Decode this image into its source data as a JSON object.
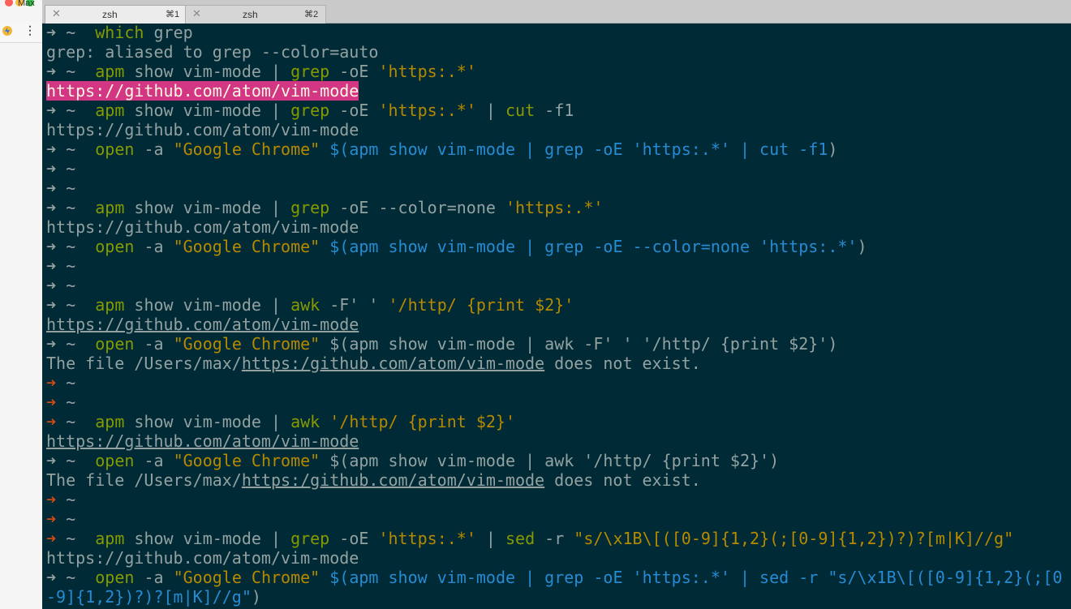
{
  "browser": {
    "window_label": "Max"
  },
  "tabs": [
    {
      "title": "zsh",
      "shortcut": "⌘1",
      "close": "✕"
    },
    {
      "title": "zsh",
      "shortcut": "⌘2",
      "close": "✕"
    }
  ],
  "colors": {
    "background": "#002b36",
    "prompt_arrow": "#93a1a1",
    "prompt_arrow_error": "#cb4b16",
    "command": "#859900",
    "string": "#b58900",
    "subshell": "#268bd2",
    "text": "#93a1a1",
    "highlight": "#d33682"
  },
  "terminal": {
    "lines": [
      {
        "k": "cmd",
        "err": false,
        "segs": [
          [
            "g",
            "which"
          ],
          [
            "t",
            " grep"
          ]
        ]
      },
      {
        "k": "out",
        "segs": [
          [
            "t",
            "grep: aliased to grep --color=auto"
          ]
        ]
      },
      {
        "k": "cmd",
        "err": false,
        "segs": [
          [
            "g",
            "apm"
          ],
          [
            "t",
            " show vim-mode | "
          ],
          [
            "g",
            "grep"
          ],
          [
            "t",
            " -oE "
          ],
          [
            "y",
            "'https:.*'"
          ]
        ]
      },
      {
        "k": "out",
        "segs": [
          [
            "hl",
            "https://github.com/atom/vim-mode"
          ]
        ]
      },
      {
        "k": "cmd",
        "err": false,
        "segs": [
          [
            "g",
            "apm"
          ],
          [
            "t",
            " show vim-mode | "
          ],
          [
            "g",
            "grep"
          ],
          [
            "t",
            " -oE "
          ],
          [
            "y",
            "'https:.*'"
          ],
          [
            "t",
            " | "
          ],
          [
            "g",
            "cut"
          ],
          [
            "t",
            " -f1"
          ]
        ]
      },
      {
        "k": "out",
        "segs": [
          [
            "t",
            "https://github.com/atom/vim-mode"
          ]
        ]
      },
      {
        "k": "cmd",
        "err": false,
        "segs": [
          [
            "g",
            "open"
          ],
          [
            "t",
            " -a "
          ],
          [
            "y",
            "\"Google Chrome\""
          ],
          [
            "t",
            " "
          ],
          [
            "b",
            "$(apm show vim-mode | grep -oE 'https:.*' | cut -f1"
          ],
          [
            "t",
            ")"
          ]
        ]
      },
      {
        "k": "cmd",
        "err": false,
        "segs": []
      },
      {
        "k": "cmd",
        "err": false,
        "segs": []
      },
      {
        "k": "cmd",
        "err": false,
        "segs": [
          [
            "g",
            "apm"
          ],
          [
            "t",
            " show vim-mode | "
          ],
          [
            "g",
            "grep"
          ],
          [
            "t",
            " -oE --color=none "
          ],
          [
            "y",
            "'https:.*'"
          ]
        ]
      },
      {
        "k": "out",
        "segs": [
          [
            "t",
            "https://github.com/atom/vim-mode"
          ]
        ]
      },
      {
        "k": "cmd",
        "err": false,
        "segs": [
          [
            "g",
            "open"
          ],
          [
            "t",
            " -a "
          ],
          [
            "y",
            "\"Google Chrome\""
          ],
          [
            "t",
            " "
          ],
          [
            "b",
            "$(apm show vim-mode | grep -oE --color=none 'https:.*'"
          ],
          [
            "t",
            ")"
          ]
        ]
      },
      {
        "k": "cmd",
        "err": false,
        "segs": []
      },
      {
        "k": "cmd",
        "err": false,
        "segs": []
      },
      {
        "k": "cmd",
        "err": false,
        "segs": [
          [
            "g",
            "apm"
          ],
          [
            "t",
            " show vim-mode | "
          ],
          [
            "g",
            "awk"
          ],
          [
            "t",
            " -F' ' "
          ],
          [
            "y",
            "'/http/ {print $2}'"
          ]
        ]
      },
      {
        "k": "out",
        "segs": [
          [
            "u",
            "https://github.com/atom/vim-mode"
          ]
        ]
      },
      {
        "k": "cmd",
        "err": false,
        "segs": [
          [
            "g",
            "open"
          ],
          [
            "t",
            " -a "
          ],
          [
            "y",
            "\"Google Chrome\""
          ],
          [
            "t",
            " $(apm show vim-mode | awk -F' ' '/http/ {print $2}')"
          ]
        ]
      },
      {
        "k": "out",
        "segs": [
          [
            "t",
            "The file /Users/max/"
          ],
          [
            "u",
            "https:/github.com/atom/vim-mode"
          ],
          [
            "t",
            " does not exist."
          ]
        ]
      },
      {
        "k": "cmd",
        "err": true,
        "segs": []
      },
      {
        "k": "cmd",
        "err": true,
        "segs": []
      },
      {
        "k": "cmd",
        "err": true,
        "segs": [
          [
            "g",
            "apm"
          ],
          [
            "t",
            " show vim-mode | "
          ],
          [
            "g",
            "awk"
          ],
          [
            "t",
            " "
          ],
          [
            "y",
            "'/http/ {print $2}'"
          ]
        ]
      },
      {
        "k": "out",
        "segs": [
          [
            "u",
            "https://github.com/atom/vim-mode"
          ]
        ]
      },
      {
        "k": "cmd",
        "err": false,
        "segs": [
          [
            "g",
            "open"
          ],
          [
            "t",
            " -a "
          ],
          [
            "y",
            "\"Google Chrome\""
          ],
          [
            "t",
            " $(apm show vim-mode | awk '/http/ {print $2}')"
          ]
        ]
      },
      {
        "k": "out",
        "segs": [
          [
            "t",
            "The file /Users/max/"
          ],
          [
            "u",
            "https:/github.com/atom/vim-mode"
          ],
          [
            "t",
            " does not exist."
          ]
        ]
      },
      {
        "k": "cmd",
        "err": true,
        "segs": []
      },
      {
        "k": "cmd",
        "err": true,
        "segs": []
      },
      {
        "k": "cmd",
        "err": true,
        "segs": [
          [
            "g",
            "apm"
          ],
          [
            "t",
            " show vim-mode | "
          ],
          [
            "g",
            "grep"
          ],
          [
            "t",
            " -oE "
          ],
          [
            "y",
            "'https:.*'"
          ],
          [
            "t",
            " | "
          ],
          [
            "g",
            "sed"
          ],
          [
            "t",
            " -r "
          ],
          [
            "y",
            "\"s/\\x1B\\[([0-9]{1,2}(;[0-9]{1,2})?)?[m|K]//g\""
          ]
        ]
      },
      {
        "k": "out",
        "segs": [
          [
            "t",
            "https://github.com/atom/vim-mode"
          ]
        ]
      },
      {
        "k": "cmd",
        "err": false,
        "segs": [
          [
            "g",
            "open"
          ],
          [
            "t",
            " -a "
          ],
          [
            "y",
            "\"Google Chrome\""
          ],
          [
            "t",
            " "
          ],
          [
            "b",
            "$(apm show vim-mode | grep -oE 'https:.*' | sed -r \"s/\\x1B\\[([0-9]{1,2}(;[0"
          ]
        ]
      },
      {
        "k": "out",
        "segs": [
          [
            "b",
            "-9]{1,2})?)?[m|K]//g\""
          ],
          [
            "t",
            ")"
          ]
        ]
      }
    ],
    "prompt_arrow": "➜",
    "prompt_dir": "~"
  }
}
